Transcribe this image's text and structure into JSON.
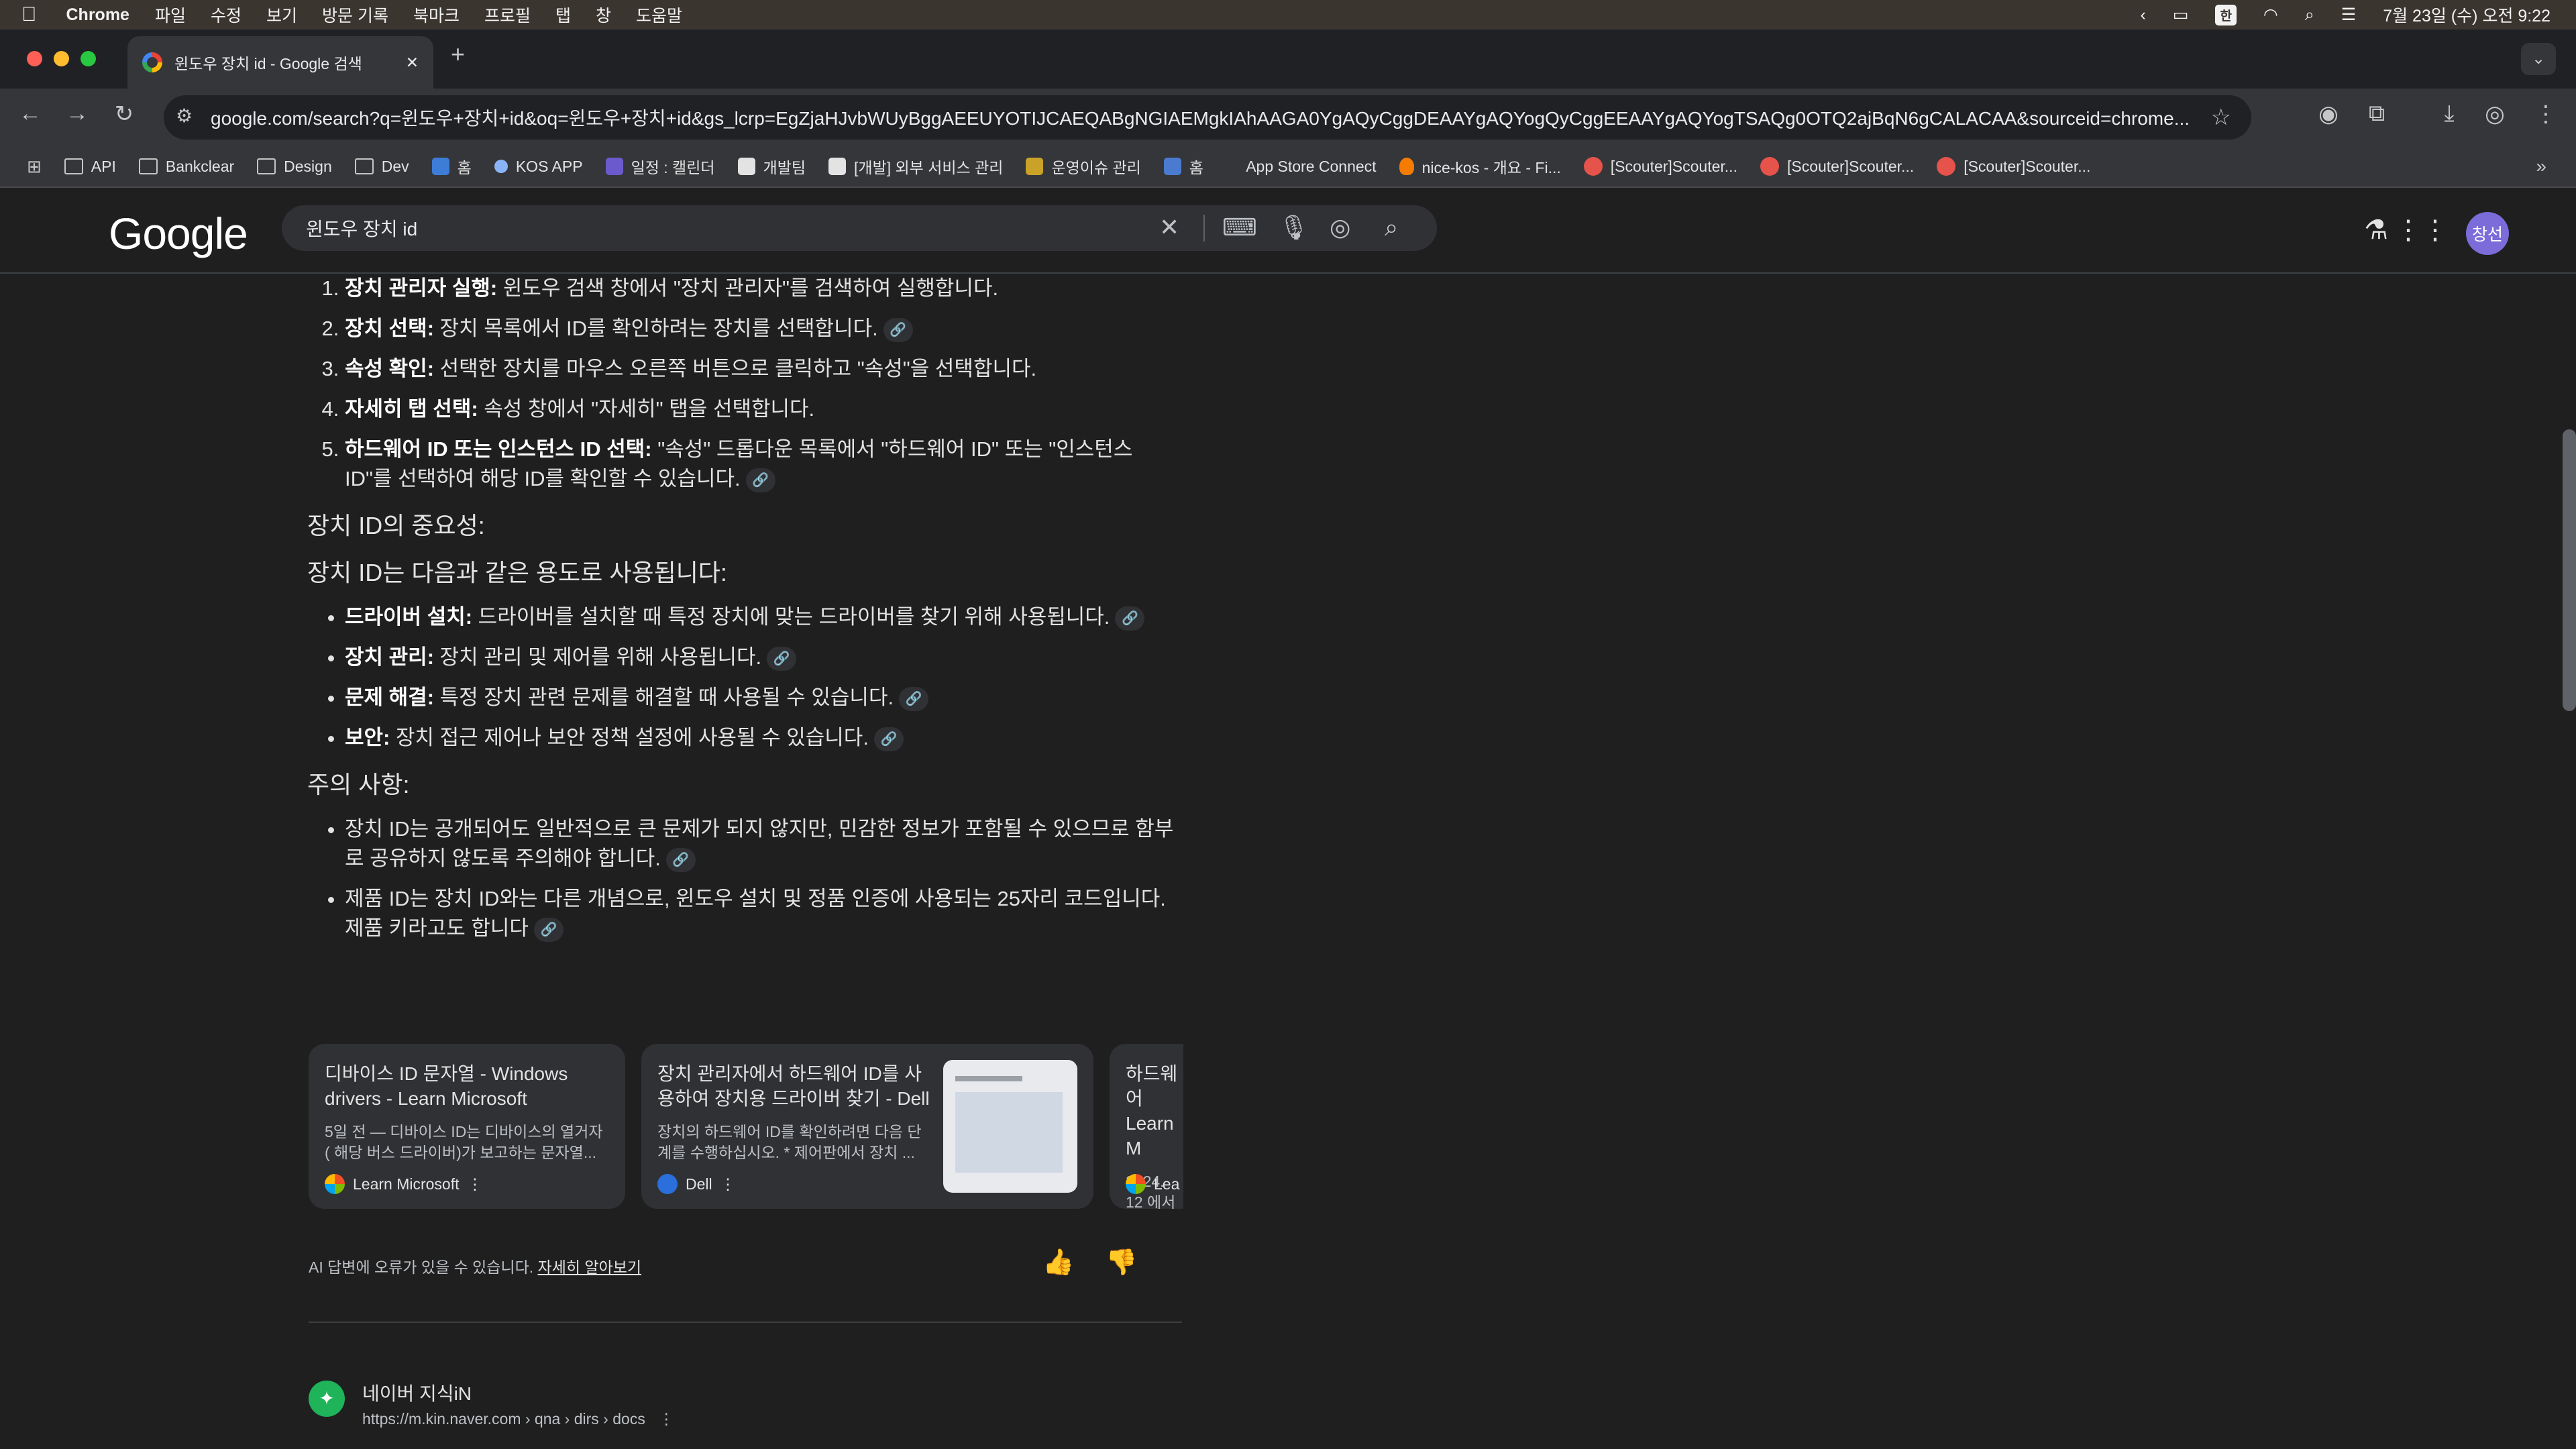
{
  "menubar": {
    "app": "Chrome",
    "items": [
      "파일",
      "수정",
      "보기",
      "방문 기록",
      "북마크",
      "프로필",
      "탭",
      "창",
      "도움말"
    ],
    "ime": "한",
    "datetime": "7월 23일 (수) 오전 9:22"
  },
  "tab": {
    "title": "윈도우 장치 id - Google 검색",
    "close": "✕",
    "new": "+"
  },
  "toolbar": {
    "url": "google.com/search?q=윈도우+장치+id&oq=윈도우+장치+id&gs_lcrp=EgZjaHJvbWUyBggAEEUYOTIJCAEQABgNGIAEMgkIAhAAGA0YgAQyCggDEAAYgAQYogQyCggEEAAYgAQYogTSAQg0OTQ2ajBqN6gCALACAA&sourceid=chrome..."
  },
  "bookmarks": [
    {
      "label": "API",
      "icon": "folder"
    },
    {
      "label": "Bankclear",
      "icon": "folder"
    },
    {
      "label": "Design",
      "icon": "folder"
    },
    {
      "label": "Dev",
      "icon": "folder"
    },
    {
      "label": "홈",
      "icon": "blue-square"
    },
    {
      "label": "KOS APP",
      "icon": "app"
    },
    {
      "label": "일정 : 캘린더",
      "icon": "calendar"
    },
    {
      "label": "개발팀",
      "icon": "notion"
    },
    {
      "label": "[개발] 외부 서비스 관리",
      "icon": "notion"
    },
    {
      "label": "운영이슈 관리",
      "icon": "board"
    },
    {
      "label": "홈",
      "icon": "arrow"
    },
    {
      "label": "App Store Connect",
      "icon": "apple"
    },
    {
      "label": "nice-kos - 개요 - Fi...",
      "icon": "fire"
    },
    {
      "label": "[Scouter]Scouter...",
      "icon": "scouter"
    },
    {
      "label": "[Scouter]Scouter...",
      "icon": "scouter"
    },
    {
      "label": "[Scouter]Scouter...",
      "icon": "scouter"
    }
  ],
  "google": {
    "logo": "Google",
    "query": "윈도우 장치 id",
    "avatar": "창선"
  },
  "steps": [
    {
      "bold": "장치 관리자 실행:",
      "text": " 윈도우 검색 창에서 \"장치 관리자\"를 검색하여 실행합니다.",
      "link": false
    },
    {
      "bold": "장치 선택:",
      "text": " 장치 목록에서 ID를 확인하려는 장치를 선택합니다.",
      "link": true
    },
    {
      "bold": "속성 확인:",
      "text": " 선택한 장치를 마우스 오른쪽 버튼으로 클릭하고 \"속성\"을 선택합니다.",
      "link": false
    },
    {
      "bold": "자세히 탭 선택:",
      "text": " 속성 창에서 \"자세히\" 탭을 선택합니다.",
      "link": false
    },
    {
      "bold": "하드웨어 ID 또는 인스턴스 ID 선택:",
      "text": " \"속성\" 드롭다운 목록에서 \"하드웨어 ID\" 또는 \"인스턴스 ID\"를 선택하여 해당 ID를 확인할 수 있습니다.",
      "link": true
    }
  ],
  "importance_heading": "장치 ID의 중요성:",
  "usage_heading": "장치 ID는 다음과 같은 용도로 사용됩니다:",
  "usages": [
    {
      "bold": "드라이버 설치:",
      "text": " 드라이버를 설치할 때 특정 장치에 맞는 드라이버를 찾기 위해 사용됩니다."
    },
    {
      "bold": "장치 관리:",
      "text": " 장치 관리 및 제어를 위해 사용됩니다."
    },
    {
      "bold": "문제 해결:",
      "text": " 특정 장치 관련 문제를 해결할 때 사용될 수 있습니다."
    },
    {
      "bold": "보안:",
      "text": " 장치 접근 제어나 보안 정책 설정에 사용될 수 있습니다."
    }
  ],
  "caution_heading": "주의 사항:",
  "cautions": [
    "장치 ID는 공개되어도 일반적으로 큰 문제가 되지 않지만, 민감한 정보가 포함될 수 있으므로 함부로 공유하지 않도록 주의해야 합니다.",
    "제품 ID는 장치 ID와는 다른 개념으로, 윈도우 설치 및 정품 인증에 사용되는 25자리 코드입니다. 제품 키라고도 합니다"
  ],
  "cards": [
    {
      "title": "디바이스 ID 문자열 - Windows drivers - Learn Microsoft",
      "snippet": "5일 전 — 디바이스 ID는 디바이스의 열거자 ( 해당 버스 드라이버)가 보고하는 문자열...",
      "source": "Learn Microsoft"
    },
    {
      "title": "장치 관리자에서 하드웨어 ID를 사용하여 장치용 드라이버 찾기 - Dell",
      "snippet": "장치의 하드웨어 ID를 확인하려면 다음 단계를 수행하십시오. * 제어판에서 장치 ...",
      "source": "Dell"
    },
    {
      "title": "하드웨어 Learn M",
      "snippet": "2024. 12 에서 디바",
      "source": "Lea"
    }
  ],
  "feedback": {
    "note": "AI 답변에 오류가 있을 수 있습니다.",
    "link": "자세히 알아보기"
  },
  "result": {
    "site": "네이버 지식iN",
    "url": "https://m.kin.naver.com › qna › dirs › docs"
  },
  "colors": {
    "accent_avatar": "#7b6cd9",
    "background": "#1f1f1f"
  }
}
